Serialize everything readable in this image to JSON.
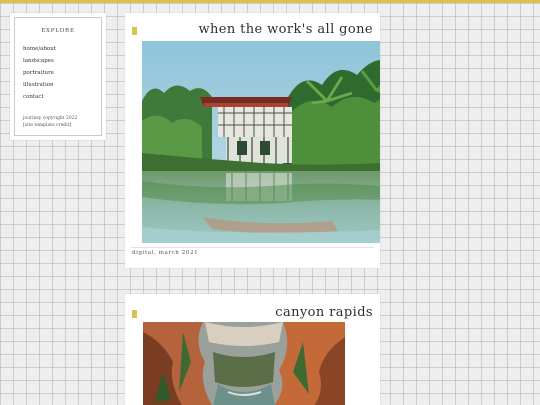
{
  "sidebar": {
    "heading": "EXPLORE",
    "nav": [
      "home/about",
      "landscapes",
      "portraiture",
      "illustration",
      "contact"
    ],
    "copyright": "jourinsy copyright 2022",
    "credit": "[site template credit]"
  },
  "posts": [
    {
      "title": "when the work's all gone",
      "caption": "digital, march 2021",
      "image": "painting-stilt-house-on-lake"
    },
    {
      "title": "canyon rapids",
      "caption": "",
      "image": "painting-canyon-river"
    }
  ],
  "colors": {
    "accent": "#d9c34a",
    "card": "#ffffff",
    "grid_background": "#eeeeee",
    "text": "#2e2e2e"
  }
}
